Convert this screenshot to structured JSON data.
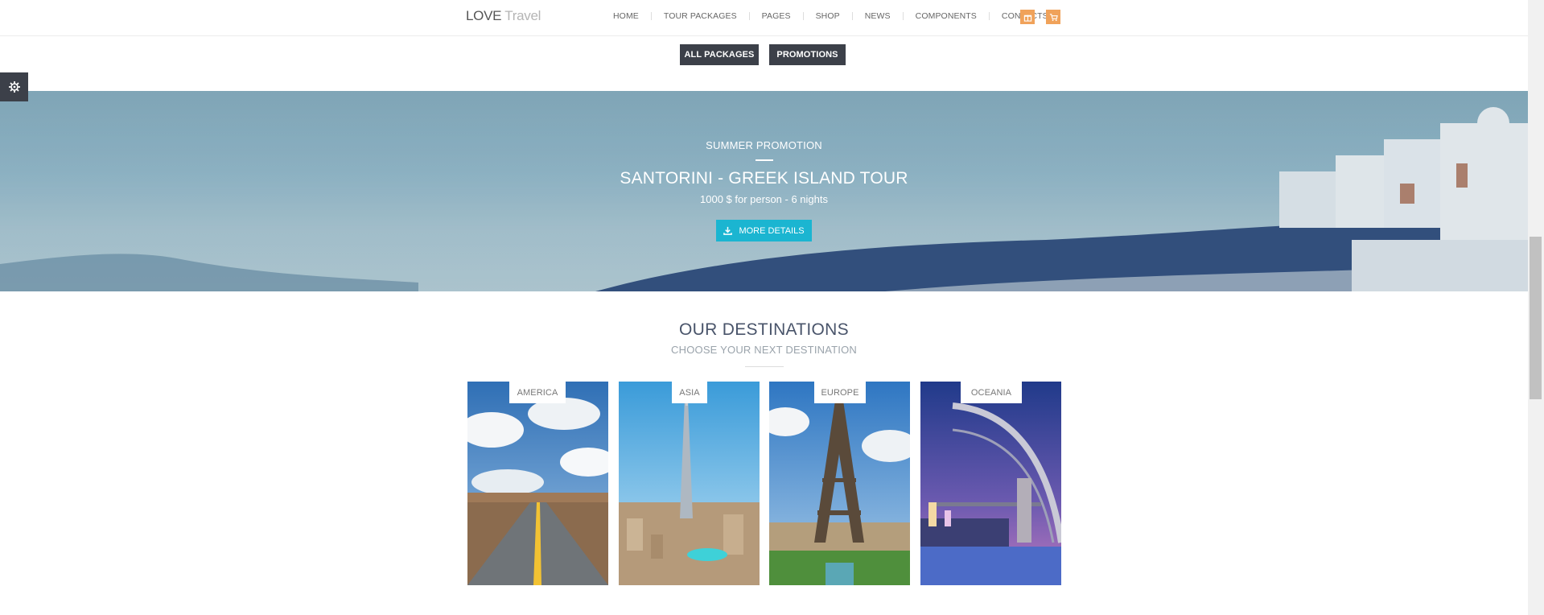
{
  "brand": {
    "primary": "LOVE",
    "secondary": "Travel"
  },
  "nav": {
    "items": [
      "HOME",
      "TOUR PACKAGES",
      "PAGES",
      "SHOP",
      "NEWS",
      "COMPONENTS",
      "CONTACTS"
    ],
    "icons": [
      "gift-icon",
      "cart-icon"
    ]
  },
  "tabs": {
    "all": "ALL PACKAGES",
    "promotions": "PROMOTIONS"
  },
  "hero": {
    "kicker": "SUMMER PROMOTION",
    "title": "SANTORINI - GREEK ISLAND TOUR",
    "subtitle": "1000 $ for person - 6 nights",
    "button": "MORE DETAILS"
  },
  "destinations": {
    "title": "OUR DESTINATIONS",
    "subtitle": "CHOOSE YOUR NEXT DESTINATION",
    "items": [
      "AMERICA",
      "ASIA",
      "EUROPE",
      "OCEANIA"
    ]
  },
  "colors": {
    "accent": "#1bb5d1",
    "dark": "#3c4049",
    "orange": "#f0a25a"
  }
}
